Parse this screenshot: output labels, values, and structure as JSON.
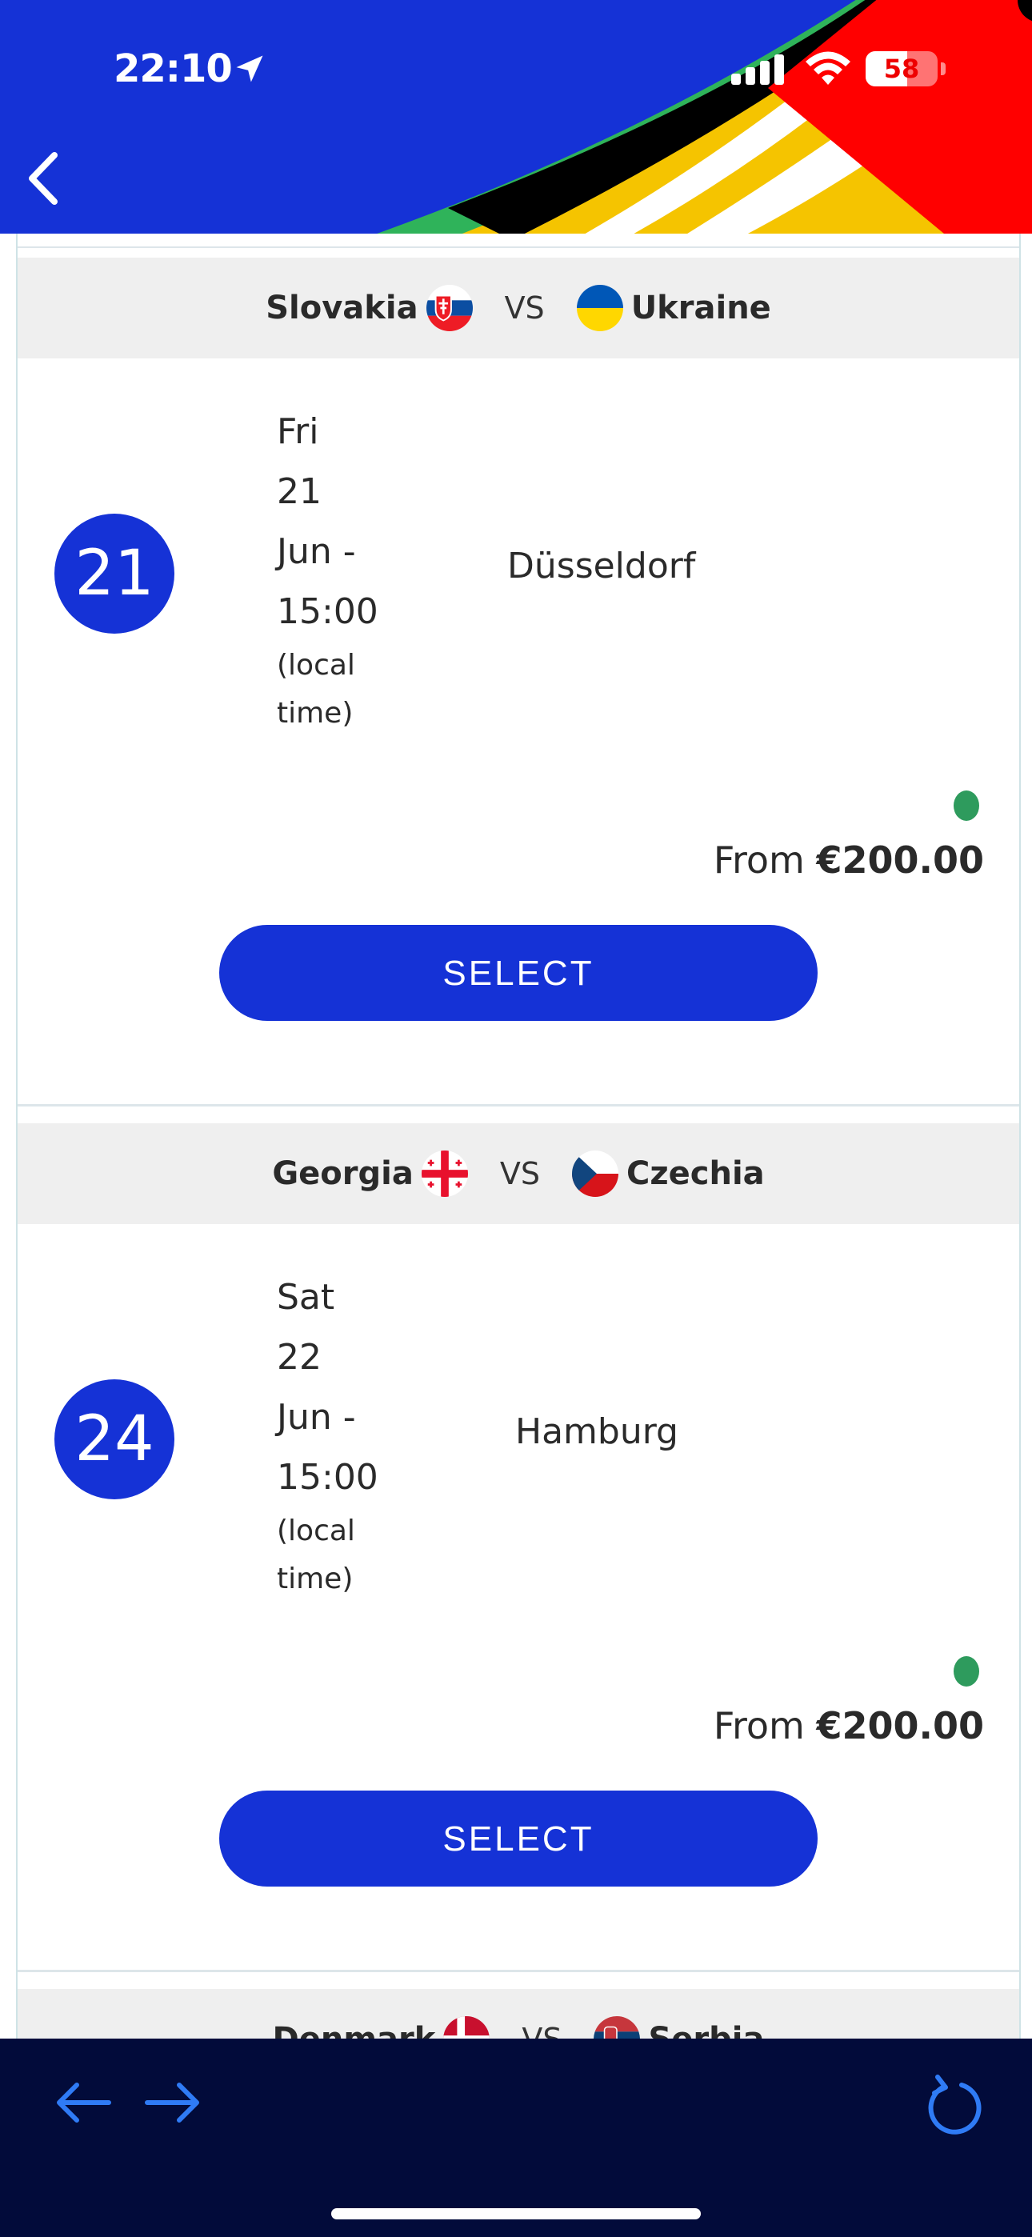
{
  "status_bar": {
    "time": "22:10",
    "battery": "58",
    "battery_level": 0.58,
    "icons": [
      "location-arrow-icon",
      "signal-icon",
      "wifi-icon",
      "battery-icon"
    ]
  },
  "header": {
    "back_icon": "chevron-left-icon"
  },
  "matches": [
    {
      "home": "Slovakia",
      "home_flag": "slovakia-flag-icon",
      "vs": "VS",
      "away": "Ukraine",
      "away_flag": "ukraine-flag-icon",
      "match_number": "21",
      "date_lines": [
        "Fri",
        "21",
        "Jun -",
        "15:00"
      ],
      "local_lines": [
        "(local",
        "time)"
      ],
      "venue": "Düsseldorf",
      "from_label": "From",
      "price": "€200.00",
      "select_label": "SELECT"
    },
    {
      "home": "Georgia",
      "home_flag": "georgia-flag-icon",
      "vs": "VS",
      "away": "Czechia",
      "away_flag": "czechia-flag-icon",
      "match_number": "24",
      "date_lines": [
        "Sat",
        "22",
        "Jun -",
        "15:00"
      ],
      "local_lines": [
        "(local",
        "time)"
      ],
      "venue": "Hamburg",
      "from_label": "From",
      "price": "€200.00",
      "select_label": "SELECT"
    },
    {
      "home": "Denmark",
      "home_flag": "denmark-flag-icon",
      "vs": "VS",
      "away": "Serbia",
      "away_flag": "serbia-flag-icon"
    }
  ],
  "colors": {
    "brand_blue": "#1532d6",
    "availability_green": "#2e9b5d",
    "bottom_bar": "#020b3a",
    "header_band": "#efefef"
  },
  "browser_bar": {
    "icons": [
      "arrow-left-icon",
      "arrow-right-icon",
      "reload-icon"
    ]
  }
}
